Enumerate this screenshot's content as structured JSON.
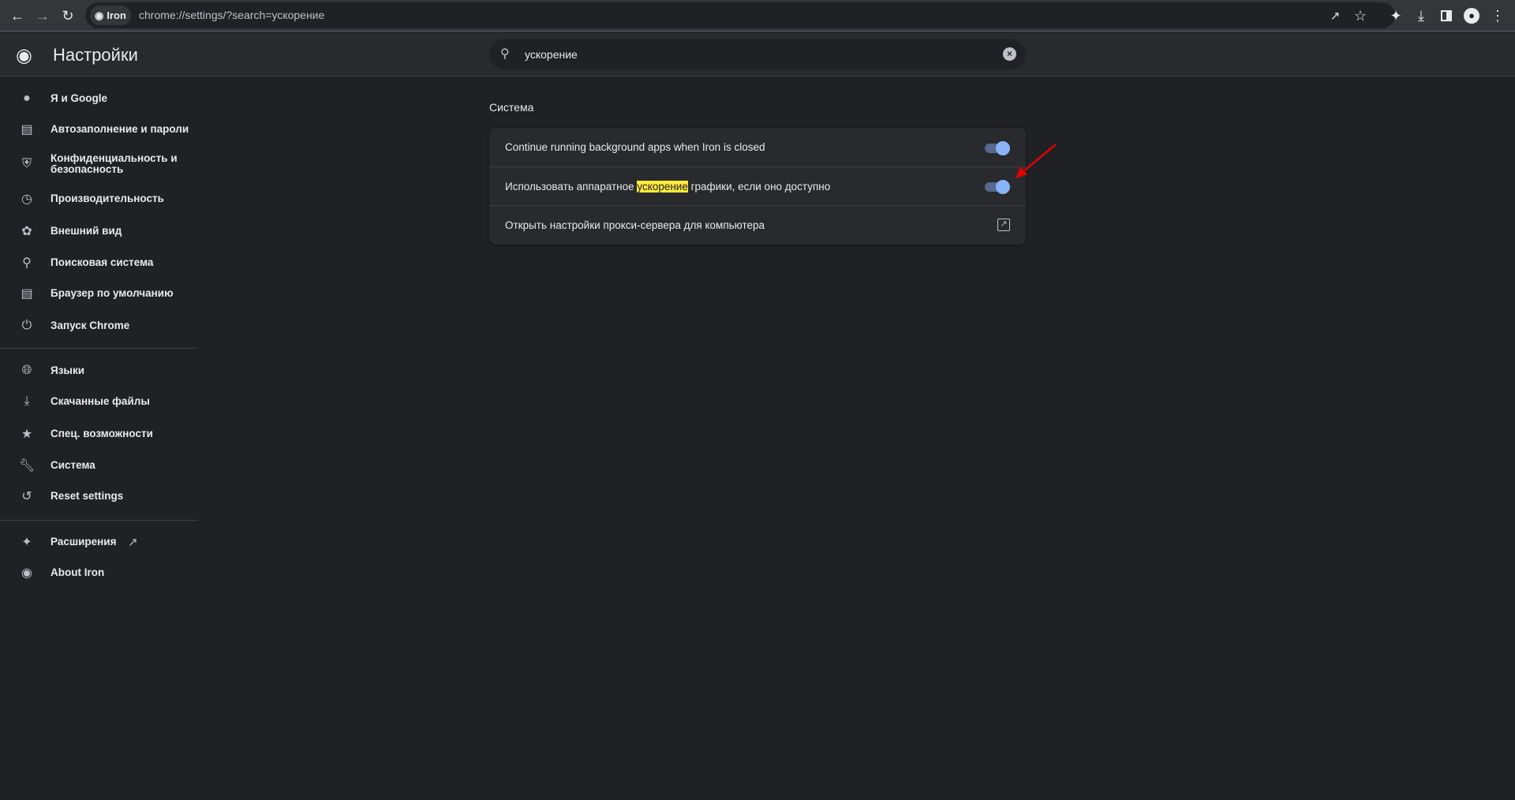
{
  "browser": {
    "chip_label": "Iron",
    "url": "chrome://settings/?search=ускорение"
  },
  "header": {
    "title": "Настройки"
  },
  "search": {
    "value": "ускорение"
  },
  "sidebar": {
    "items": [
      {
        "label": "Я и Google",
        "icon": "person-icon"
      },
      {
        "label": "Автозаполнение и пароли",
        "icon": "clipboard-icon"
      },
      {
        "label": "Конфиденциальность и безопасность",
        "icon": "shield-icon"
      },
      {
        "label": "Производительность",
        "icon": "speedometer-icon"
      },
      {
        "label": "Внешний вид",
        "icon": "palette-icon"
      },
      {
        "label": "Поисковая система",
        "icon": "search-icon"
      },
      {
        "label": "Браузер по умолчанию",
        "icon": "browser-icon"
      },
      {
        "label": "Запуск Chrome",
        "icon": "power-icon"
      },
      {
        "label": "Языки",
        "icon": "globe-icon"
      },
      {
        "label": "Скачанные файлы",
        "icon": "download-icon"
      },
      {
        "label": "Спец. возможности",
        "icon": "accessibility-icon"
      },
      {
        "label": "Система",
        "icon": "wrench-icon"
      },
      {
        "label": "Reset settings",
        "icon": "history-icon"
      },
      {
        "label": "Расширения",
        "icon": "puzzle-icon"
      },
      {
        "label": "About Iron",
        "icon": "chrome-logo-icon"
      }
    ]
  },
  "main": {
    "section_title": "Система",
    "rows": [
      {
        "label": "Continue running background apps when Iron is closed",
        "enabled": true
      },
      {
        "label_before": "Использовать аппаратное ",
        "label_highlight": "ускорение",
        "label_after": " графики, если оно доступно",
        "enabled": true
      },
      {
        "label": "Открыть настройки прокси-сервера для компьютера"
      }
    ]
  },
  "colors": {
    "accent": "#8ab4f8",
    "highlight": "#ffeb3b",
    "annotation_arrow": "#e00000"
  }
}
